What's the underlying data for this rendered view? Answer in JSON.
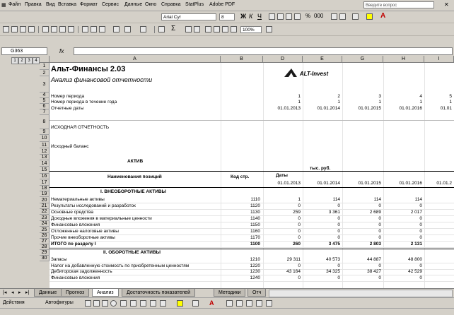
{
  "menu": [
    "Файл",
    "Правка",
    "Вид",
    "Вставка",
    "Формат",
    "Сервис",
    "Данные",
    "Окно",
    "Справка",
    "StatPlus",
    "Adobe PDF"
  ],
  "ask_placeholder": "Введите вопрос",
  "toolbar": {
    "font_name": "Arial Cyr",
    "font_size": "8",
    "zoom": "100%"
  },
  "name_box": "G363",
  "fx_label": "fx",
  "outline_levels": [
    "1",
    "2",
    "3",
    "4"
  ],
  "columns": [
    "A",
    "B",
    "D",
    "E",
    "G",
    "H",
    "I"
  ],
  "rows": [
    "1",
    "2",
    "3",
    "4",
    "5",
    "6",
    "7",
    "8",
    "9",
    "10",
    "11",
    "12",
    "13",
    "14",
    "15",
    "16",
    "17",
    "18",
    "19",
    "20",
    "21",
    "22",
    "23",
    "24",
    "25",
    "26",
    "27",
    "28",
    "29",
    "30"
  ],
  "sheet": {
    "title": "Альт-Финансы 2.03",
    "subtitle": "Анализ финансовой отчетности",
    "logo_text": "ALT-Invest",
    "period_num_label": "Номер периода",
    "period_year_label": "Номер периода в течение года",
    "report_dates_label": "Отчетные даты",
    "period_nums": [
      "1",
      "2",
      "3",
      "4",
      "5"
    ],
    "period_year": [
      "1",
      "1",
      "1",
      "1",
      "1"
    ],
    "report_dates": [
      "01.01.2013",
      "01.01.2014",
      "01.01.2015",
      "01.01.2016",
      "01.01"
    ],
    "section_initial": "ИСХОДНАЯ ОТЧЕТНОСТЬ",
    "section_balance": "Исходный баланс",
    "aktiv": "АКТИВ",
    "units": "тыс. руб.",
    "col_name": "Наименования позиций",
    "col_code": "Код стр.",
    "col_dates": "Даты",
    "dates_row": [
      "01.01.2013",
      "01.01.2014",
      "01.01.2015",
      "01.01.2016",
      "01.01.2"
    ],
    "section1": "I. ВНЕОБОРОТНЫЕ АКТИВЫ",
    "section2": "II. ОБОРОТНЫЕ АКТИВЫ",
    "items": [
      {
        "name": "Нематериальные активы",
        "code": "1110",
        "d": "1",
        "e": "114",
        "g": "114",
        "h": "114"
      },
      {
        "name": "Результаты исследований и разработок",
        "code": "1120",
        "d": "0",
        "e": "0",
        "g": "0",
        "h": "0"
      },
      {
        "name": "Основные средства",
        "code": "1130",
        "d": "259",
        "e": "3 361",
        "g": "2 689",
        "h": "2 017"
      },
      {
        "name": "Доходные вложения в материальные ценности",
        "code": "1140",
        "d": "0",
        "e": "0",
        "g": "0",
        "h": "0"
      },
      {
        "name": "Финансовые вложения",
        "code": "1150",
        "d": "0",
        "e": "0",
        "g": "0",
        "h": "0"
      },
      {
        "name": "Отложенные налоговые активы",
        "code": "1160",
        "d": "0",
        "e": "0",
        "g": "0",
        "h": "0"
      },
      {
        "name": "Прочие внеоборотные активы",
        "code": "1170",
        "d": "0",
        "e": "0",
        "g": "0",
        "h": "0"
      },
      {
        "name": "ИТОГО по разделу I",
        "code": "1100",
        "d": "260",
        "e": "3 475",
        "g": "2 803",
        "h": "2 131"
      }
    ],
    "items2": [
      {
        "name": "Запасы",
        "code": "1210",
        "d": "29 311",
        "e": "40 573",
        "g": "44 887",
        "h": "48 800"
      },
      {
        "name": "Налог на добавленную стоимость по приобретенным ценностям",
        "code": "1220",
        "d": "0",
        "e": "0",
        "g": "0",
        "h": "0"
      },
      {
        "name": "Дебиторская задолженность",
        "code": "1230",
        "d": "43 164",
        "e": "34 325",
        "g": "38 427",
        "h": "42 529"
      },
      {
        "name": "Финансовые вложения",
        "code": "1240",
        "d": "0",
        "e": "0",
        "g": "0",
        "h": "0"
      }
    ]
  },
  "tabs": [
    "Данные",
    "Прогноз",
    "Анализ",
    "Достаточность показателей",
    "Методики",
    "Отч"
  ],
  "draw": {
    "actions": "Действия",
    "autoshapes": "Автофигуры"
  }
}
